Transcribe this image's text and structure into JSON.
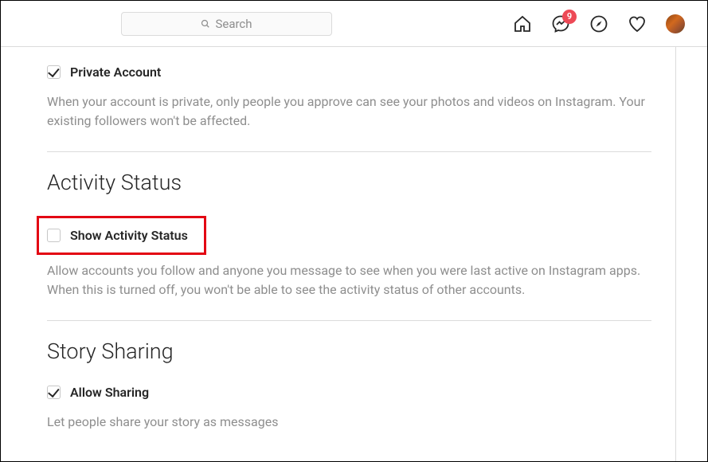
{
  "header": {
    "search_placeholder": "Search",
    "messenger_badge": "9"
  },
  "sections": {
    "private_account": {
      "checkbox_label": "Private Account",
      "description": "When your account is private, only people you approve can see your photos and videos on Instagram. Your existing followers won't be affected."
    },
    "activity_status": {
      "title": "Activity Status",
      "checkbox_label": "Show Activity Status",
      "description": "Allow accounts you follow and anyone you message to see when you were last active on Instagram apps. When this is turned off, you won't be able to see the activity status of other accounts."
    },
    "story_sharing": {
      "title": "Story Sharing",
      "checkbox_label": "Allow Sharing",
      "description": "Let people share your story as messages"
    }
  }
}
